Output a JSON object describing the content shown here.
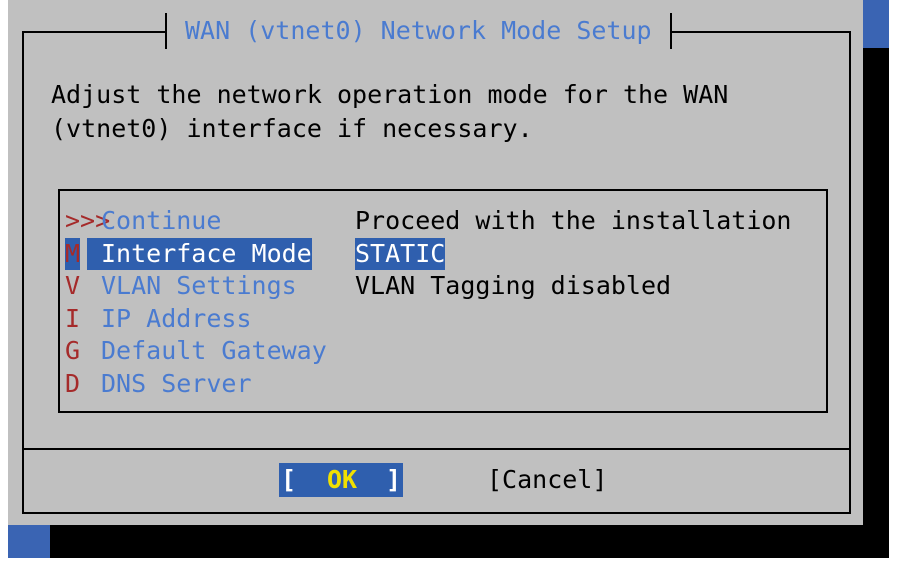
{
  "dialog": {
    "title": "WAN (vtnet0) Network Mode Setup",
    "description_lines": [
      "Adjust the network operation mode for the WAN",
      "(vtnet0) interface if necessary."
    ]
  },
  "menu": {
    "items": [
      {
        "key": ">>>",
        "label": "Continue",
        "description": "Proceed with the installation",
        "selected": false
      },
      {
        "key": "M",
        "label": "Interface Mode",
        "description": "STATIC",
        "selected": true
      },
      {
        "key": "V",
        "label": "VLAN Settings",
        "description": "VLAN Tagging disabled",
        "selected": false
      },
      {
        "key": "I",
        "label": "IP Address",
        "description": "",
        "selected": false
      },
      {
        "key": "G",
        "label": "Default Gateway",
        "description": "",
        "selected": false
      },
      {
        "key": "D",
        "label": "DNS Server",
        "description": "",
        "selected": false
      }
    ]
  },
  "buttons": {
    "ok": {
      "left_bracket": "[",
      "label": "OK",
      "right_bracket": "]"
    },
    "cancel": {
      "label": "[Cancel]"
    }
  },
  "colors": {
    "background": "#3a64b3",
    "dialog": "#c0c0c0",
    "title": "#4a7bd0",
    "hotkey": "#a52a2a",
    "selection": "#2f5fae",
    "ok_label": "#f0e000"
  }
}
